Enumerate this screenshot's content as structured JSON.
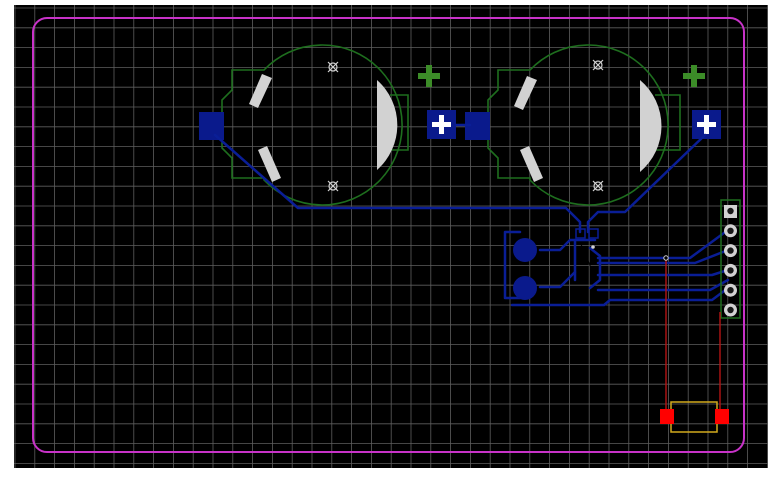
{
  "canvas": {
    "background_color": "#000000",
    "grid_color": "#5e5e5e",
    "board_outline_color": "#c832c8",
    "silkscreen_color": "#d2d2d2",
    "trace_color": "#0a1e96",
    "pad_color": "#0a1a8c",
    "courtyard_color": "#1e6e1e",
    "plus_marker_color": "#3c8c28",
    "top_trace_color": "#b41414",
    "smd_pad_color": "#ff0000",
    "component_outline_color": "#d2aa1e"
  },
  "components": {
    "battery_holders": [
      {
        "name": "coin-cell-holder-left",
        "polarity": "+"
      },
      {
        "name": "coin-cell-holder-right",
        "polarity": "+"
      }
    ],
    "header_pin_count": 6,
    "header_shape": "vertical-pin-header",
    "large_round_pads": 2,
    "smd_part": "two-pad-smd-component"
  }
}
